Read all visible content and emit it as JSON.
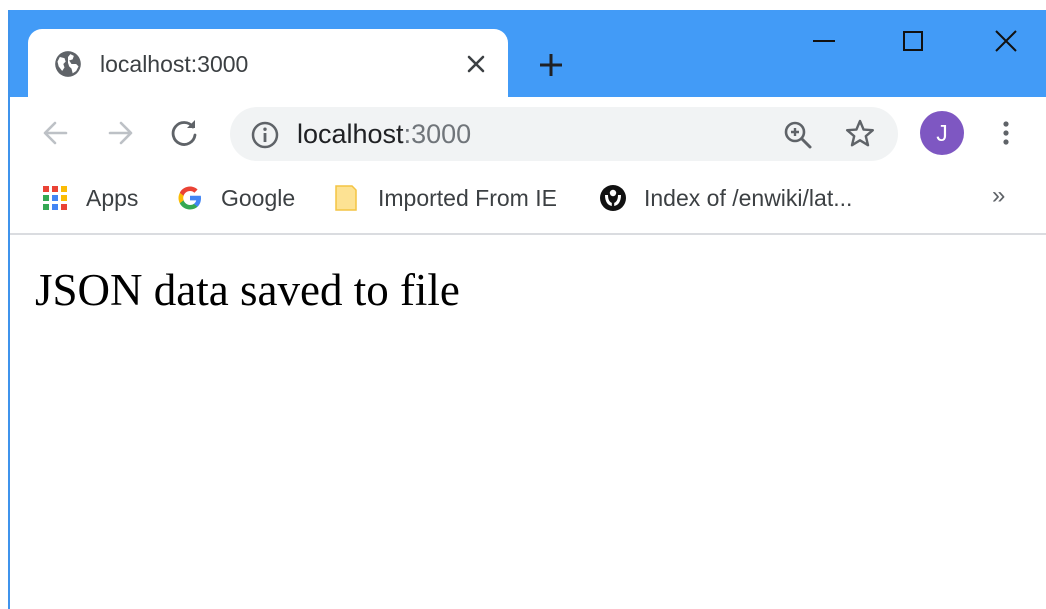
{
  "tab": {
    "title": "localhost:3000",
    "favicon": "globe-icon"
  },
  "window_controls": [
    "minimize-icon",
    "maximize-icon",
    "close-icon"
  ],
  "address_bar": {
    "host": "localhost",
    "port": ":3000"
  },
  "profile": {
    "initial": "J",
    "color": "#7e57c2"
  },
  "bookmarks": [
    {
      "label": "Apps",
      "icon": "apps-grid-icon"
    },
    {
      "label": "Google",
      "icon": "google-icon"
    },
    {
      "label": "Imported From IE",
      "icon": "folder-icon"
    },
    {
      "label": "Index of /enwiki/lat...",
      "icon": "wikimedia-icon"
    }
  ],
  "bookmarks_more": "»",
  "page": {
    "text": "JSON data saved to file"
  },
  "colors": {
    "titlebar": "#429bf7",
    "omnibox": "#f1f3f4"
  }
}
